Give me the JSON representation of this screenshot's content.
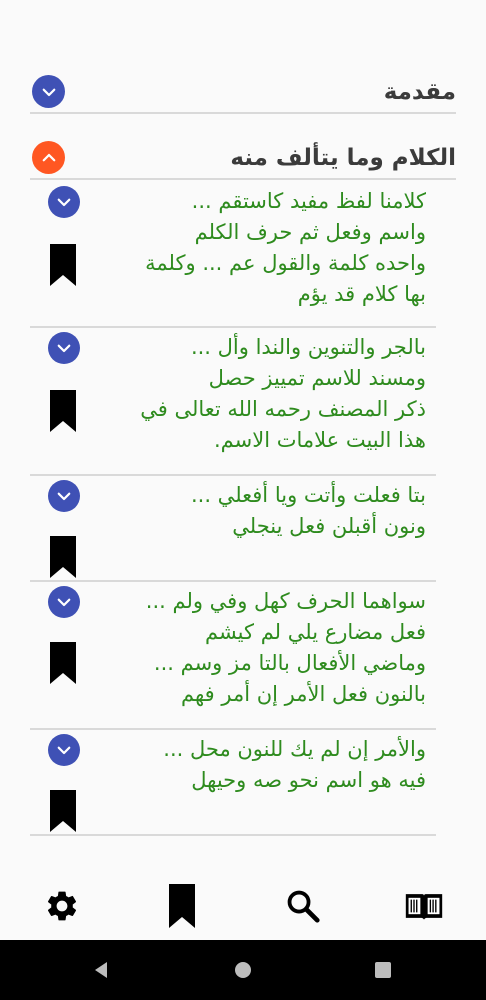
{
  "sections": [
    {
      "title": "مقدمة",
      "state": "collapsed",
      "button_color": "#3f51b5"
    },
    {
      "title": "الكلام وما يتألف منه",
      "state": "expanded",
      "button_color": "#ff5722"
    }
  ],
  "verses": [
    {
      "text": "كلامنا لفظ مفيد كاستقم ...\nواسم وفعل ثم حرف الكلم\nواحده كلمة والقول عم ... وكلمة\nبها كلام قد يؤم"
    },
    {
      "text": "بالجر والتنوين والندا وأل ...\nومسند للاسم تمييز حصل\nذكر المصنف رحمه الله تعالى في\nهذا البيت علامات الاسم."
    },
    {
      "text": "بتا فعلت وأتت ويا أفعلي ...\nونون أقبلن فعل ينجلي"
    },
    {
      "text": "سواهما الحرف كهل وفي ولم ...\nفعل مضارع يلي لم كيشم\nوماضي الأفعال بالتا مز وسم ...\nبالنون فعل الأمر إن أمر فهم"
    },
    {
      "text": "والأمر إن لم يك للنون محل ...\nفيه هو اسم نحو صه وحيهل"
    }
  ],
  "colors": {
    "verse_text": "#2e8b1e",
    "accent_blue": "#3f51b5",
    "accent_orange": "#ff5722",
    "section_title": "#3b3b3b"
  },
  "bottom_nav": [
    {
      "icon": "gear-icon"
    },
    {
      "icon": "bookmark-icon"
    },
    {
      "icon": "search-icon"
    },
    {
      "icon": "book-icon"
    }
  ],
  "system_nav": [
    {
      "icon": "back-icon"
    },
    {
      "icon": "home-icon"
    },
    {
      "icon": "recents-icon"
    }
  ]
}
